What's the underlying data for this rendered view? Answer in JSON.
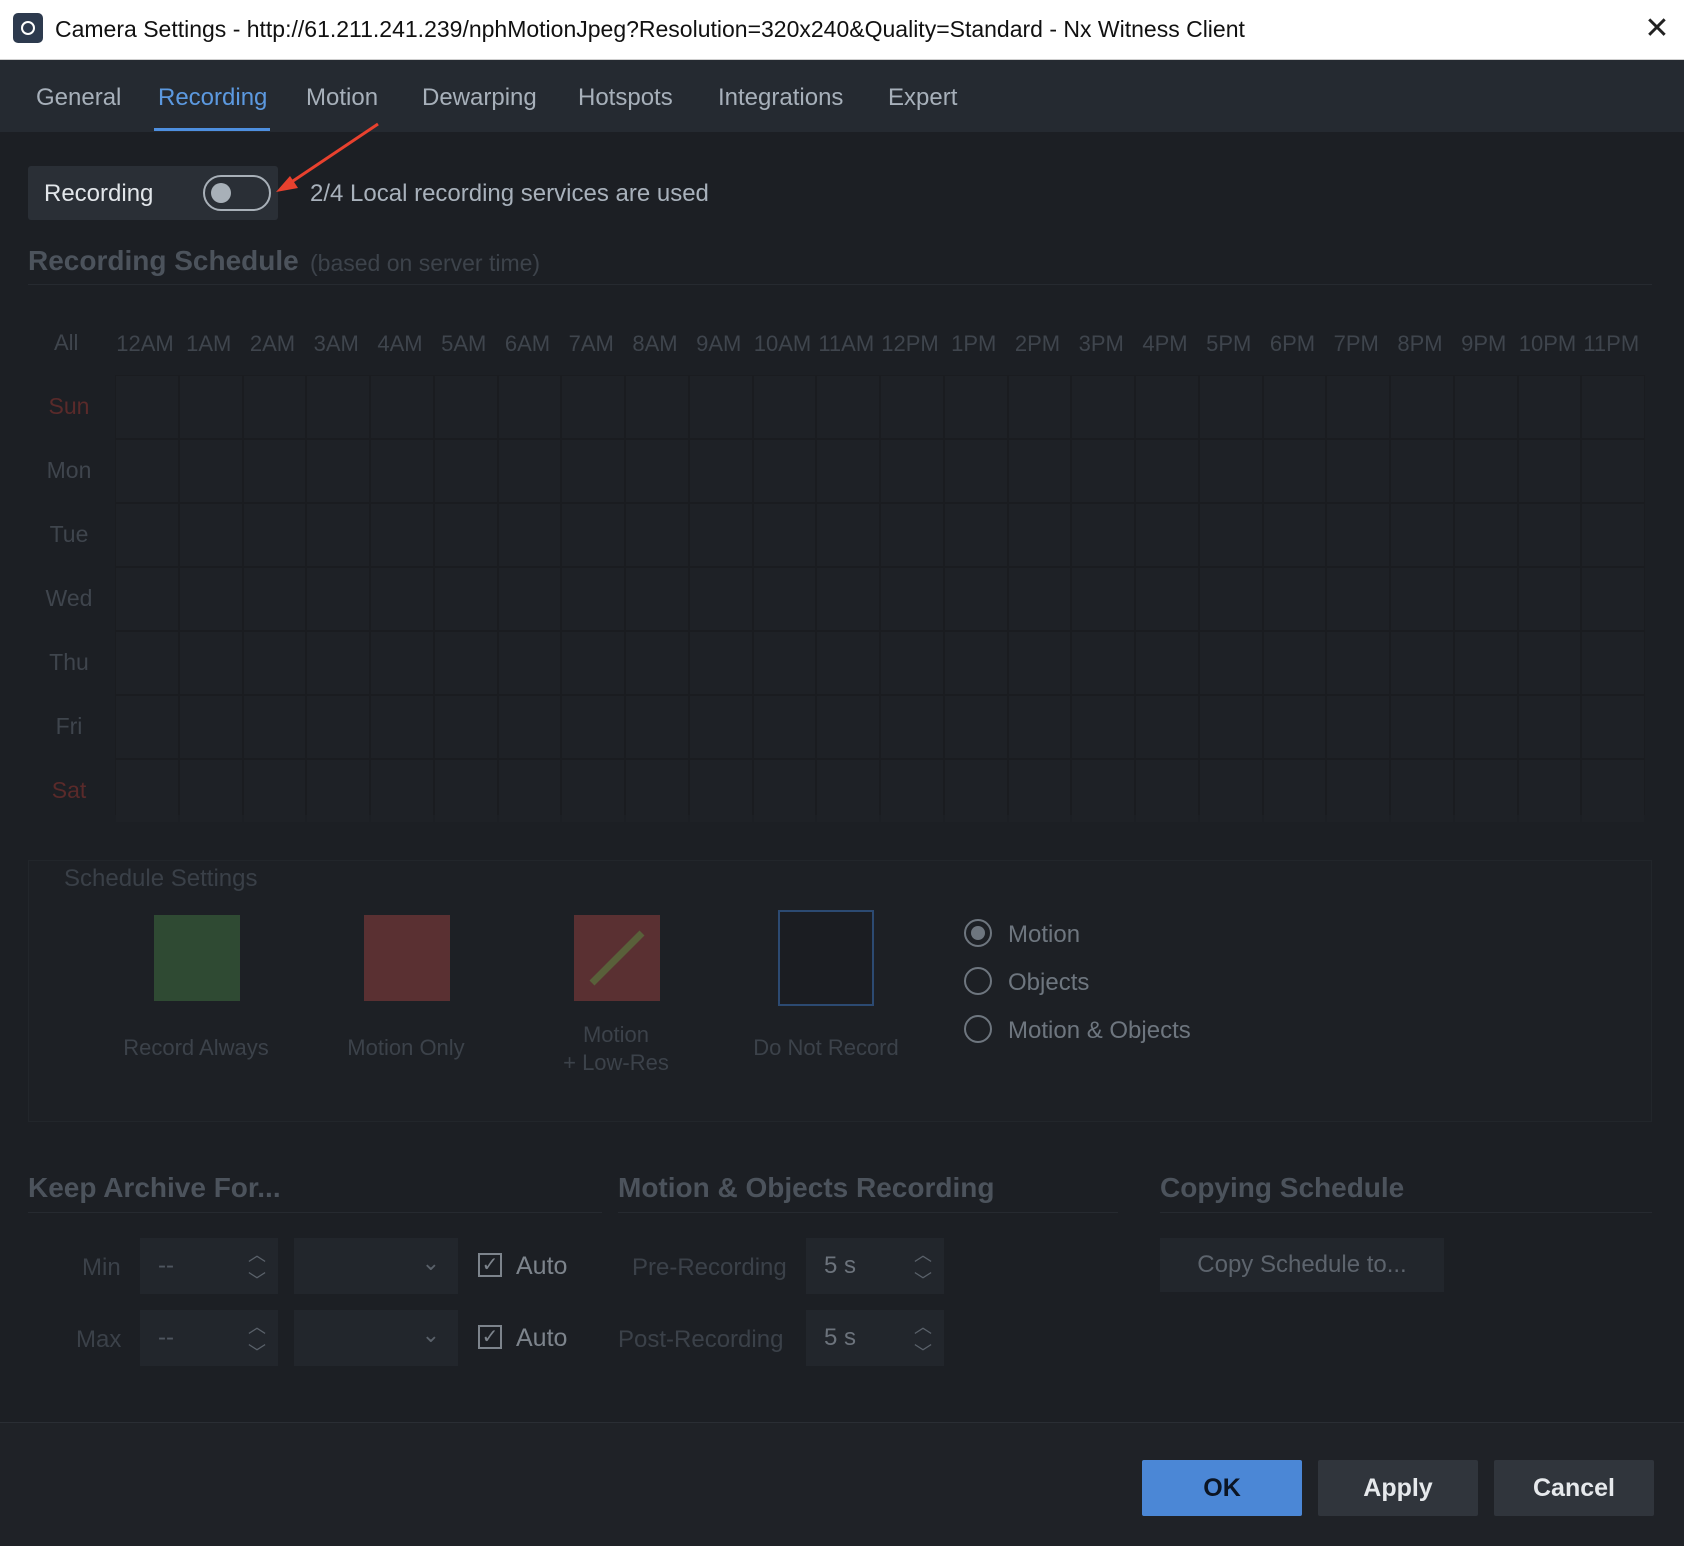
{
  "window": {
    "title": "Camera Settings - http://61.211.241.239/nphMotionJpeg?Resolution=320x240&Quality=Standard - Nx Witness Client",
    "close_glyph": "✕"
  },
  "tabs": [
    {
      "label": "General"
    },
    {
      "label": "Recording",
      "active": true
    },
    {
      "label": "Motion"
    },
    {
      "label": "Dewarping"
    },
    {
      "label": "Hotspots"
    },
    {
      "label": "Integrations"
    },
    {
      "label": "Expert"
    }
  ],
  "recording": {
    "label": "Recording",
    "enabled": false,
    "usage_text": "2/4 Local recording services are used"
  },
  "schedule": {
    "title": "Recording Schedule",
    "note": "(based on server time)",
    "all_label": "All",
    "hours": [
      "12AM",
      "1AM",
      "2AM",
      "3AM",
      "4AM",
      "5AM",
      "6AM",
      "7AM",
      "8AM",
      "9AM",
      "10AM",
      "11AM",
      "12PM",
      "1PM",
      "2PM",
      "3PM",
      "4PM",
      "5PM",
      "6PM",
      "7PM",
      "8PM",
      "9PM",
      "10PM",
      "11PM"
    ],
    "days": [
      "Sun",
      "Mon",
      "Tue",
      "Wed",
      "Thu",
      "Fri",
      "Sat"
    ]
  },
  "schedule_settings": {
    "title": "Schedule Settings",
    "modes": [
      {
        "label": "Record Always",
        "color": "#2f4a33"
      },
      {
        "label": "Motion Only",
        "color": "#5a3032"
      },
      {
        "label": "Motion\n+ Low-Res",
        "color": "#5a3032"
      },
      {
        "label": "Do Not Record",
        "color": "#1b1d22"
      }
    ],
    "triggers": [
      {
        "label": "Motion",
        "checked": true
      },
      {
        "label": "Objects",
        "checked": false
      },
      {
        "label": "Motion & Objects",
        "checked": false
      }
    ]
  },
  "keep_archive": {
    "title": "Keep Archive For...",
    "min_label": "Min",
    "max_label": "Max",
    "min_value": "--",
    "max_value": "--",
    "auto_label": "Auto",
    "min_auto": true,
    "max_auto": true
  },
  "motion_recording": {
    "title": "Motion & Objects Recording",
    "pre_label": "Pre-Recording",
    "pre_value": "5 s",
    "post_label": "Post-Recording",
    "post_value": "5 s"
  },
  "copying": {
    "title": "Copying Schedule",
    "button_label": "Copy Schedule to..."
  },
  "footer": {
    "ok_label": "OK",
    "apply_label": "Apply",
    "cancel_label": "Cancel"
  },
  "colors": {
    "accent": "#4b87d6",
    "annotation_arrow": "#e8412e"
  }
}
